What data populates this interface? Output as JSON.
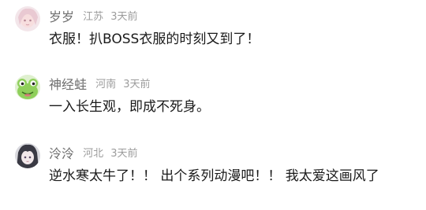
{
  "comments": [
    {
      "username": "岁岁",
      "location": "江苏",
      "time": "3天前",
      "text": "衣服！扒BOSS衣服的时刻又到了！",
      "avatar_icon": "anime-girl-pink-avatar"
    },
    {
      "username": "神经蛙",
      "location": "河南",
      "time": "3天前",
      "text": "一入长生观，即成不死身。",
      "avatar_icon": "frog-avatar"
    },
    {
      "username": "泠泠",
      "location": "河北",
      "time": "3天前",
      "text": "逆水寒太牛了！！ 出个系列动漫吧！！ 我太爱这画风了",
      "avatar_icon": "anime-girl-dark-avatar"
    }
  ],
  "colors": {
    "username": "#6e6e6e",
    "meta": "#9c9c9c",
    "text": "#1a1a1a"
  }
}
